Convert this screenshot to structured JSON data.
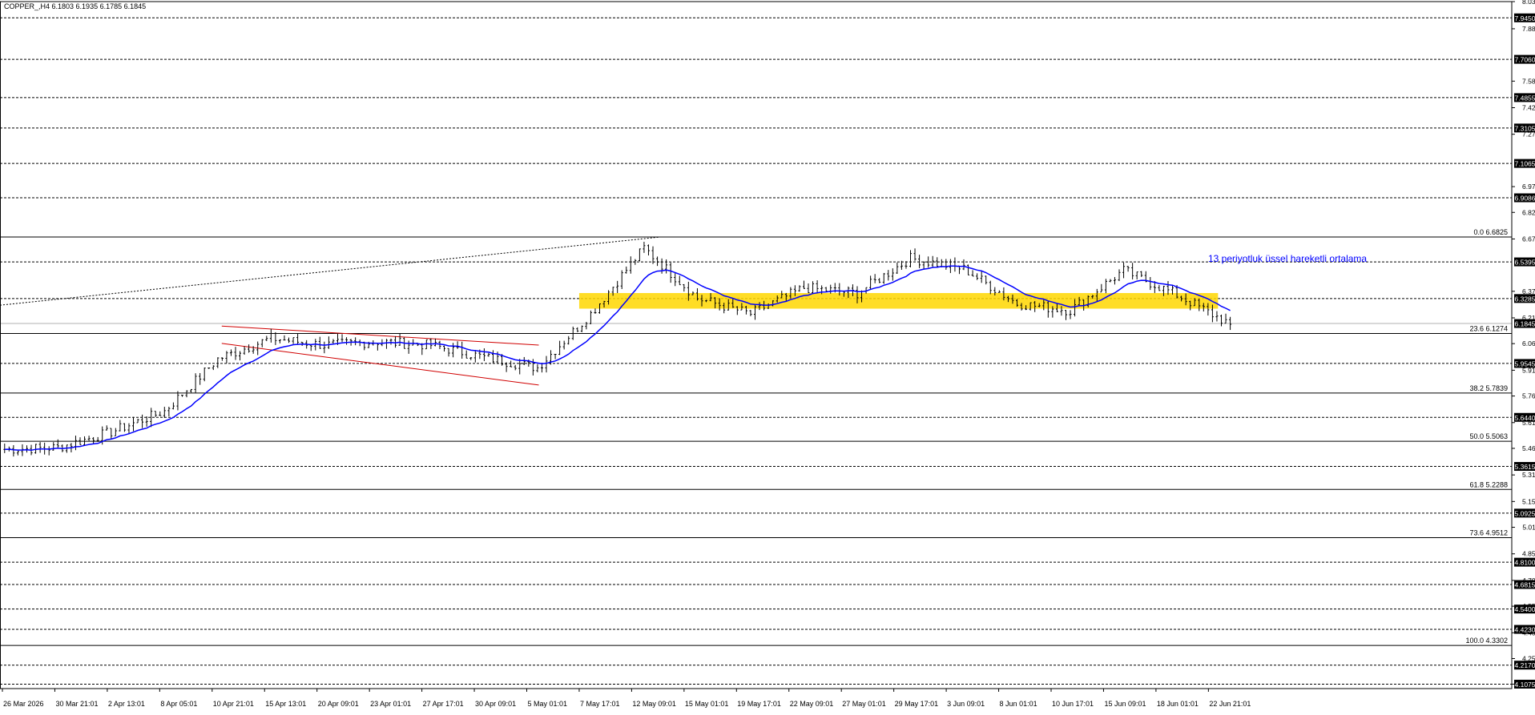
{
  "header": {
    "symbol_text": "COPPER_,H4  6.1803 6.1935 6.1785 6.1845"
  },
  "colors": {
    "background": "#ffffff",
    "grid": "#000000",
    "candle": "#000000",
    "ema": "#0000ff",
    "zone": "#ffd700",
    "channel": "#d00000",
    "annotation": "#0000ff",
    "price_tag_bg": "#000000",
    "price_tag_text": "#ffffff"
  },
  "chart_data": {
    "type": "candlestick",
    "title": "COPPER_,H4",
    "ohlc_header": {
      "open": 6.1803,
      "high": 6.1935,
      "low": 6.1785,
      "close": 6.1845
    },
    "ylim": [
      4.082,
      8.0385
    ],
    "x_time_labels": [
      "26 Mar 2026",
      "30 Mar 21:01",
      "2 Apr 13:01",
      "8 Apr 05:01",
      "10 Apr 21:01",
      "15 Apr 13:01",
      "20 Apr 09:01",
      "23 Apr 01:01",
      "27 Apr 17:01",
      "30 Apr 09:01",
      "5 May 01:01",
      "7 May 17:01",
      "12 May 09:01",
      "15 May 01:01",
      "19 May 17:01",
      "22 May 09:01",
      "27 May 01:01",
      "29 May 17:01",
      "3 Jun 09:01",
      "8 Jun 01:01",
      "10 Jun 17:01",
      "15 Jun 09:01",
      "18 Jun 01:01",
      "22 Jun 21:01"
    ],
    "price_axis_ticks": [
      "8.0385",
      "7.8820",
      "7.5805",
      "7.4275",
      "7.2745",
      "6.9730",
      "6.8245",
      "6.6715",
      "6.3700",
      "6.2170",
      "6.0687",
      "5.9155",
      "5.7670",
      "5.6140",
      "5.4655",
      "5.3125",
      "5.1595",
      "5.0110",
      "4.8580",
      "4.7050",
      "4.5565",
      "4.4035",
      "4.2550",
      "4.1075"
    ],
    "horizontal_levels": [
      "7.9450",
      "7.7060",
      "7.4855",
      "7.3105",
      "7.1065",
      "6.9086",
      "6.5395",
      "6.3285",
      "5.9545",
      "5.6440",
      "5.3615",
      "5.0925",
      "4.8100",
      "4.6815",
      "4.5400",
      "4.4230",
      "4.2170",
      "4.1075"
    ],
    "current_price": "6.1845",
    "fibonacci": [
      {
        "label": "0.0 6.6825",
        "price": 6.6825
      },
      {
        "label": "23.6 6.1274",
        "price": 6.1274
      },
      {
        "label": "38.2 5.7839",
        "price": 5.7839
      },
      {
        "label": "50.0 5.5063",
        "price": 5.5063
      },
      {
        "label": "61.8 5.2288",
        "price": 5.2288
      },
      {
        "label": "73.6 4.9512",
        "price": 4.9512
      },
      {
        "label": "100.0 4.3302",
        "price": 4.3302
      }
    ],
    "resistance_zone": {
      "from_price": 6.27,
      "to_price": 6.36,
      "from_label": "7 May 17:01",
      "to_label": "22 Jun 21:01"
    },
    "descending_channel": {
      "upper": [
        {
          "t": "10 Apr 21:01",
          "price": 6.17
        },
        {
          "t": "5 May 01:01",
          "price": 6.06
        }
      ],
      "lower": [
        {
          "t": "10 Apr 21:01",
          "price": 6.07
        },
        {
          "t": "5 May 01:01",
          "price": 5.83
        }
      ]
    },
    "annotation": "13 periyotluk üssel hareketli ortalama",
    "ema_period": 13,
    "close_path": [
      [
        "26 Mar 2026",
        5.46
      ],
      [
        "30 Mar 21:01",
        5.47
      ],
      [
        "2 Apr 13:01",
        5.56
      ],
      [
        "8 Apr 05:01",
        5.68
      ],
      [
        "10 Apr 21:01",
        5.98
      ],
      [
        "15 Apr 13:01",
        6.1
      ],
      [
        "20 Apr 09:01",
        6.06
      ],
      [
        "23 Apr 01:01",
        6.08
      ],
      [
        "27 Apr 17:01",
        6.06
      ],
      [
        "30 Apr 09:01",
        5.99
      ],
      [
        "5 May 01:01",
        5.93
      ],
      [
        "7 May 17:01",
        6.24
      ],
      [
        "12 May 09:01",
        6.62
      ],
      [
        "15 May 01:01",
        6.33
      ],
      [
        "19 May 17:01",
        6.24
      ],
      [
        "22 May 09:01",
        6.39
      ],
      [
        "27 May 01:01",
        6.36
      ],
      [
        "29 May 17:01",
        6.56
      ],
      [
        "3 Jun 09:01",
        6.5
      ],
      [
        "8 Jun 01:01",
        6.3
      ],
      [
        "10 Jun 17:01",
        6.26
      ],
      [
        "15 Jun 09:01",
        6.49
      ],
      [
        "18 Jun 01:01",
        6.35
      ],
      [
        "22 Jun 21:01",
        6.18
      ]
    ]
  }
}
